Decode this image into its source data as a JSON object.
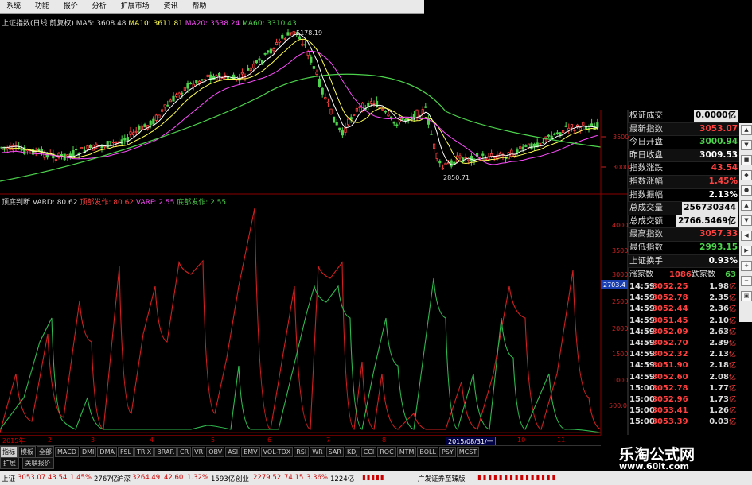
{
  "menu": [
    "系统",
    "功能",
    "报价",
    "分析",
    "扩展市场",
    "资讯",
    "帮助"
  ],
  "menu_right": "",
  "main_header": {
    "title": "上证指数(日线 前复权)",
    "ma5": "MA5: 3608.48",
    "ma10": "MA10: 3611.81",
    "ma20": "MA20: 3538.24",
    "ma60": "MA60: 3310.43"
  },
  "annotations": {
    "high": "5178.19",
    "low": "2850.71"
  },
  "price_axis": [
    "3500",
    "3000"
  ],
  "ind_header": {
    "name": "顶底判断",
    "vard": "VARD: 80.62",
    "top": "顶部发作: 80.62",
    "varf": "VARF: 2.55",
    "bottom": "底部发作: 2.55"
  },
  "ind_axis": [
    "4000",
    "3500",
    "3000",
    "2500",
    "2000",
    "1500",
    "1000",
    "500.0"
  ],
  "ind_marker": "2703.4",
  "info": [
    {
      "label": "权证成交",
      "value": "0.0000亿",
      "color": "#ffffff",
      "hl": true
    },
    {
      "label": "最新指数",
      "value": "3053.07",
      "color": "#ff4040"
    },
    {
      "label": "今日开盘",
      "value": "3000.94",
      "color": "#4cd34c"
    },
    {
      "label": "昨日收盘",
      "value": "3009.53",
      "color": "#ffffff"
    },
    {
      "label": "指数涨跌",
      "value": "43.54",
      "color": "#ff4040"
    },
    {
      "label": "指数涨幅",
      "value": "1.45%",
      "color": "#ff4040"
    },
    {
      "label": "指数振幅",
      "value": "2.13%",
      "color": "#ffffff"
    },
    {
      "label": "总成交量",
      "value": "256730344",
      "color": "#ffff54",
      "hl": true
    },
    {
      "label": "总成交额",
      "value": "2766.5469亿",
      "color": "#ffff54",
      "hl": true
    },
    {
      "label": "最高指数",
      "value": "3057.33",
      "color": "#ff4040"
    },
    {
      "label": "最低指数",
      "value": "2993.15",
      "color": "#4cd34c"
    },
    {
      "label": "上证换手",
      "value": "0.93%",
      "color": "#ffffff"
    }
  ],
  "updown": {
    "up_label": "涨家数",
    "up": "1086",
    "down_label": "跌家数",
    "down": "63"
  },
  "ticks": [
    {
      "t": "14:59",
      "p": "3052.25",
      "v": "1.98",
      "u": "亿"
    },
    {
      "t": "14:59",
      "p": "3052.78",
      "v": "2.35",
      "u": "亿"
    },
    {
      "t": "14:59",
      "p": "3052.44",
      "v": "2.36",
      "u": "亿"
    },
    {
      "t": "14:59",
      "p": "3051.45",
      "v": "2.10",
      "u": "亿"
    },
    {
      "t": "14:59",
      "p": "3052.09",
      "v": "2.63",
      "u": "亿"
    },
    {
      "t": "14:59",
      "p": "3052.70",
      "v": "2.39",
      "u": "亿"
    },
    {
      "t": "14:59",
      "p": "3052.32",
      "v": "2.13",
      "u": "亿"
    },
    {
      "t": "14:59",
      "p": "3051.90",
      "v": "2.18",
      "u": "亿"
    },
    {
      "t": "14:59",
      "p": "3052.60",
      "v": "2.08",
      "u": "亿"
    },
    {
      "t": "15:00",
      "p": "3052.78",
      "v": "1.77",
      "u": "亿"
    },
    {
      "t": "15:00",
      "p": "3052.96",
      "v": "1.73",
      "u": "亿"
    },
    {
      "t": "15:00",
      "p": "3053.41",
      "v": "1.26",
      "u": "亿"
    },
    {
      "t": "15:00",
      "p": "3053.39",
      "v": "0.03",
      "u": "亿"
    }
  ],
  "time_axis": [
    "2015年",
    "2",
    "3",
    "4",
    "5",
    "6",
    "7",
    "8",
    "10",
    "11"
  ],
  "date_tag": "2015/08/31/一",
  "tabs": [
    "指标",
    "模板",
    "全部",
    "MACD",
    "DMI",
    "DMA",
    "FSL",
    "TRIX",
    "BRAR",
    "CR",
    "VR",
    "OBV",
    "ASI",
    "EMV",
    "VOL-TDX",
    "RSI",
    "WR",
    "SAR",
    "KDJ",
    "CCI",
    "ROC",
    "MTM",
    "BOLL",
    "PSY",
    "MCST"
  ],
  "tabs2": [
    "扩展",
    "关联报价"
  ],
  "status": {
    "sh_label": "上证",
    "sh_price": "3053.07",
    "sh_chg": "43.54",
    "sh_pct": "1.45%",
    "sh_vol": "2767亿",
    "hs_label": "沪深",
    "hs_price": "3264.49",
    "hs_chg": "42.60",
    "hs_pct": "1.32%",
    "hs_vol": "1593亿",
    "cy_label": "创业",
    "cy_price": "2279.52",
    "cy_chg": "74.15",
    "cy_pct": "3.36%",
    "cy_vol": "1224亿",
    "broker": "广发证券至臻版"
  },
  "watermark": {
    "name": "乐淘公式网",
    "url": "www.60lt.com"
  },
  "colors": {
    "up": "#ff4040",
    "down": "#4cd34c",
    "ma5": "#ffffff",
    "ma10": "#ffff54",
    "ma20": "#ff4cff",
    "ma60": "#4cd34c"
  }
}
